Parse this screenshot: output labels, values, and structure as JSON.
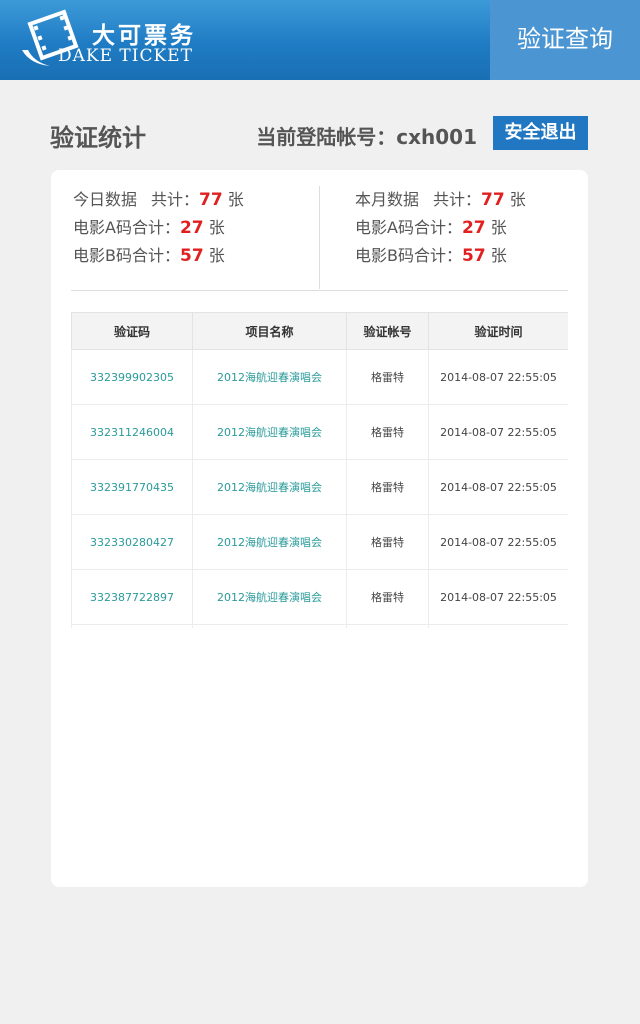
{
  "header": {
    "logo_cn": "大可票务",
    "logo_en": "DAKE TICKET",
    "right_title": "验证查询"
  },
  "title_row": {
    "title": "验证统计",
    "account_label": "当前登陆帐号：cxh001",
    "logout_label": "安全退出"
  },
  "stats": {
    "today": {
      "label": "今日数据",
      "total_label": "共计：",
      "total": "77",
      "unit": "张",
      "a_label": "电影A码合计：",
      "a_value": "27",
      "b_label": "电影B码合计：",
      "b_value": "57"
    },
    "month": {
      "label": "本月数据",
      "total_label": "共计：",
      "total": "77",
      "unit": "张",
      "a_label": "电影A码合计：",
      "a_value": "27",
      "b_label": "电影B码合计：",
      "b_value": "57"
    }
  },
  "table": {
    "headers": [
      "验证码",
      "项目名称",
      "验证帐号",
      "验证时间"
    ],
    "rows": [
      {
        "code": "332399902305",
        "project": "2012海航迎春演唱会",
        "account": "格雷特",
        "time": "2014-08-07 22:55:05"
      },
      {
        "code": "332311246004",
        "project": "2012海航迎春演唱会",
        "account": "格雷特",
        "time": "2014-08-07 22:55:05"
      },
      {
        "code": "332391770435",
        "project": "2012海航迎春演唱会",
        "account": "格雷特",
        "time": "2014-08-07 22:55:05"
      },
      {
        "code": "332330280427",
        "project": "2012海航迎春演唱会",
        "account": "格雷特",
        "time": "2014-08-07 22:55:05"
      },
      {
        "code": "332387722897",
        "project": "2012海航迎春演唱会",
        "account": "格雷特",
        "time": "2014-08-07 22:55:05"
      }
    ]
  }
}
